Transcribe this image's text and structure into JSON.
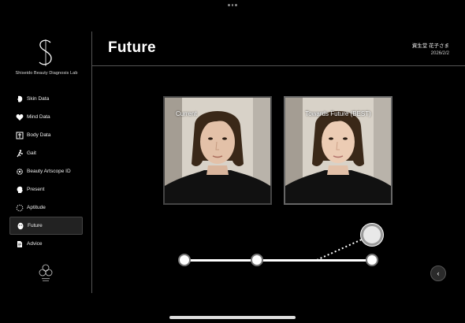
{
  "brand": {
    "name": "Shiseido Beauty Diagnosis Lab"
  },
  "sidebar": {
    "items": [
      {
        "label": "Skin Data",
        "icon": "face-icon",
        "active": false
      },
      {
        "label": "Mind Data",
        "icon": "heart-icon",
        "active": false
      },
      {
        "label": "Body Data",
        "icon": "body-icon",
        "active": false
      },
      {
        "label": "Gait",
        "icon": "walking-icon",
        "active": false
      },
      {
        "label": "Beauty Artscope ID",
        "icon": "gear-icon",
        "active": false
      },
      {
        "label": "Present",
        "icon": "head-profile-icon",
        "active": false
      },
      {
        "label": "Aptitude",
        "icon": "dotted-circle-icon",
        "active": false
      },
      {
        "label": "Future",
        "icon": "face-mask-icon",
        "active": true
      },
      {
        "label": "Advice",
        "icon": "document-icon",
        "active": false
      }
    ]
  },
  "header": {
    "title": "Future",
    "user_name": "資生堂 花子さま",
    "date": "2026/2/2"
  },
  "photos": {
    "current_label": "Current",
    "future_label": "Towards Future (BEST)"
  },
  "slider": {
    "stops": 3,
    "selected_stop": 3
  },
  "colors": {
    "background": "#000000",
    "text": "#ffffff",
    "divider": "#555555",
    "active_item_bg": "#222222"
  }
}
